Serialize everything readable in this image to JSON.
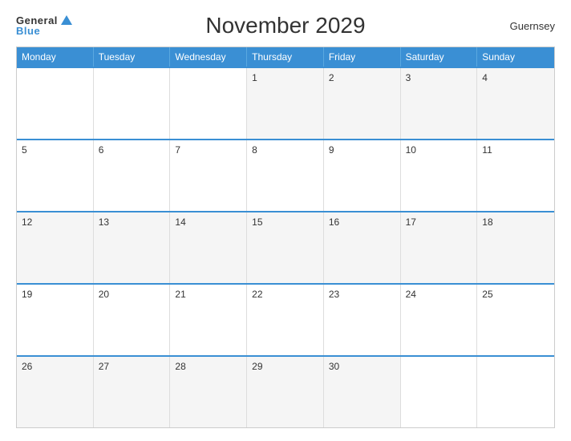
{
  "header": {
    "logo_general": "General",
    "logo_blue": "Blue",
    "title": "November 2029",
    "country": "Guernsey"
  },
  "weekdays": [
    "Monday",
    "Tuesday",
    "Wednesday",
    "Thursday",
    "Friday",
    "Saturday",
    "Sunday"
  ],
  "weeks": [
    [
      {
        "day": "",
        "empty": true
      },
      {
        "day": "",
        "empty": true
      },
      {
        "day": "",
        "empty": true
      },
      {
        "day": "1"
      },
      {
        "day": "2"
      },
      {
        "day": "3"
      },
      {
        "day": "4"
      }
    ],
    [
      {
        "day": "5"
      },
      {
        "day": "6"
      },
      {
        "day": "7"
      },
      {
        "day": "8"
      },
      {
        "day": "9"
      },
      {
        "day": "10"
      },
      {
        "day": "11"
      }
    ],
    [
      {
        "day": "12"
      },
      {
        "day": "13"
      },
      {
        "day": "14"
      },
      {
        "day": "15"
      },
      {
        "day": "16"
      },
      {
        "day": "17"
      },
      {
        "day": "18"
      }
    ],
    [
      {
        "day": "19"
      },
      {
        "day": "20"
      },
      {
        "day": "21"
      },
      {
        "day": "22"
      },
      {
        "day": "23"
      },
      {
        "day": "24"
      },
      {
        "day": "25"
      }
    ],
    [
      {
        "day": "26"
      },
      {
        "day": "27"
      },
      {
        "day": "28"
      },
      {
        "day": "29"
      },
      {
        "day": "30"
      },
      {
        "day": "",
        "empty": true
      },
      {
        "day": "",
        "empty": true
      }
    ]
  ]
}
